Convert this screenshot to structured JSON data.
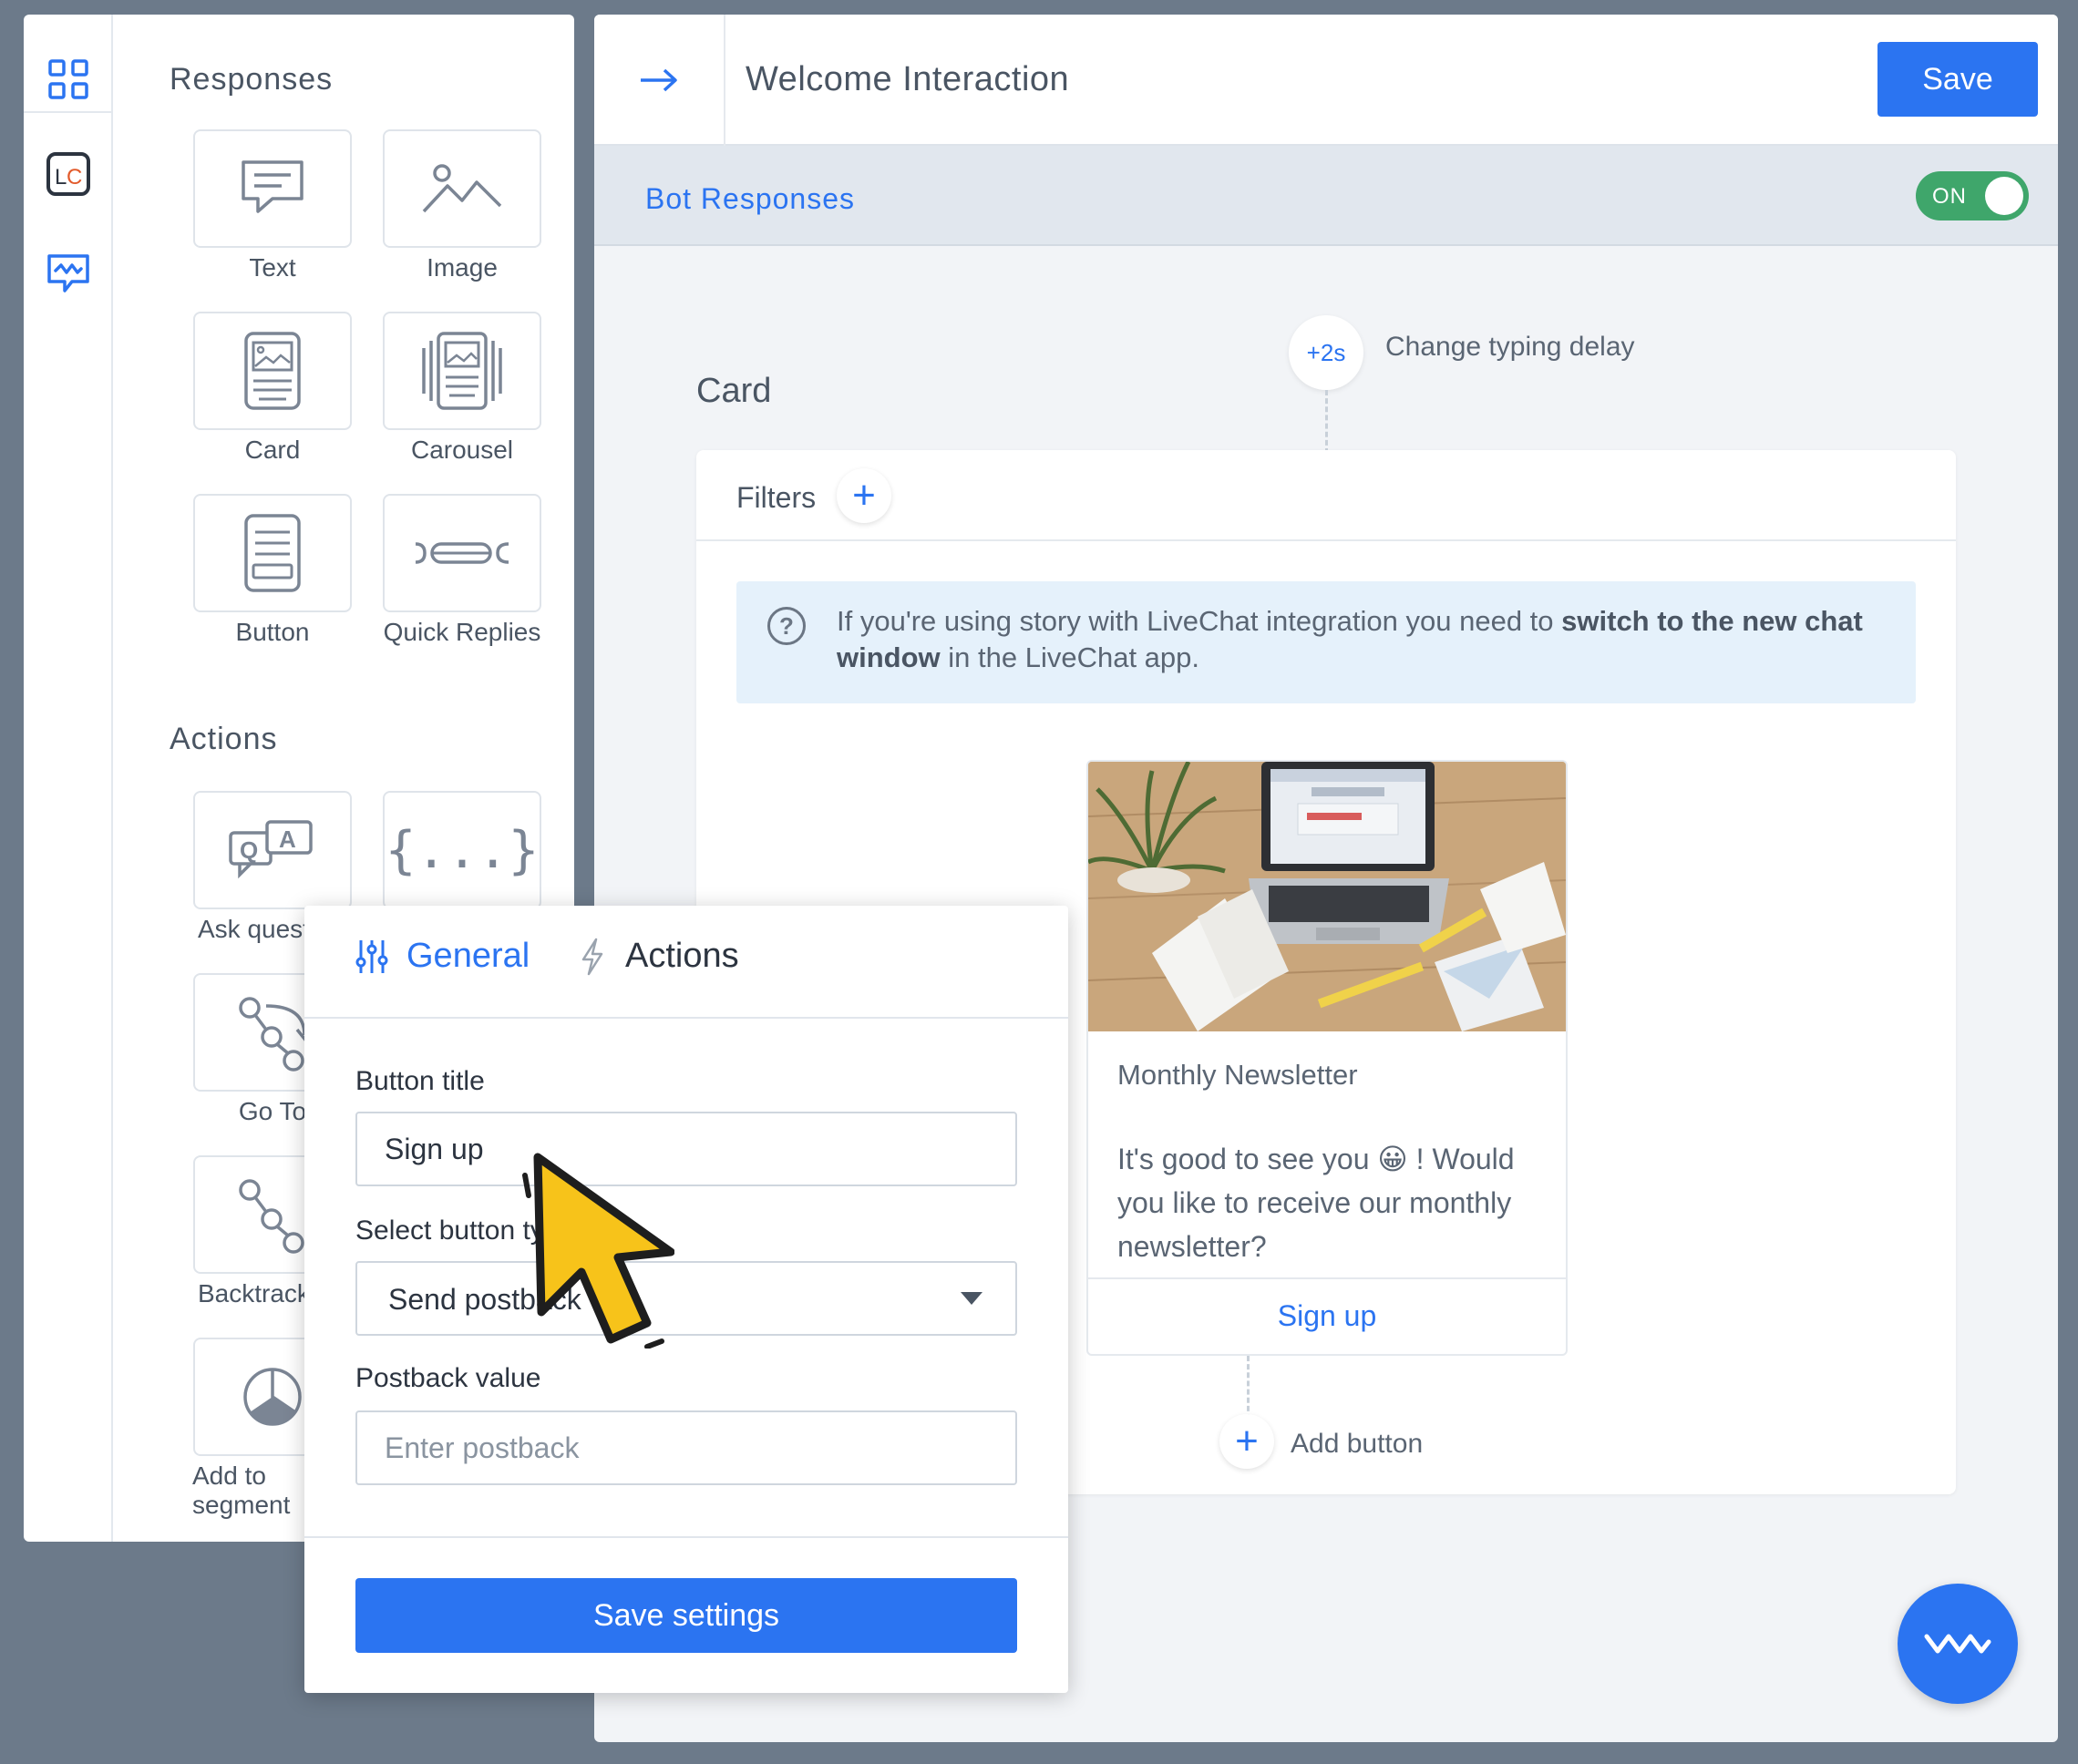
{
  "sidebar": {
    "responses_title": "Responses",
    "responses": [
      {
        "label": "Text",
        "icon": "text-bubble-icon"
      },
      {
        "label": "Image",
        "icon": "image-icon"
      },
      {
        "label": "Card",
        "icon": "card-icon"
      },
      {
        "label": "Carousel",
        "icon": "carousel-icon"
      },
      {
        "label": "Button",
        "icon": "button-icon"
      },
      {
        "label": "Quick Replies",
        "icon": "quick-replies-icon"
      }
    ],
    "actions_title": "Actions",
    "actions": [
      {
        "label": "Ask question",
        "icon": "qa-icon"
      },
      {
        "label": "{...}",
        "icon": "braces-icon"
      },
      {
        "label": "Go To",
        "icon": "goto-icon"
      },
      {
        "label": "Backtracking",
        "icon": "backtracking-icon"
      },
      {
        "label": "Add to segment",
        "icon": "pie-chart-icon"
      }
    ],
    "rail_icons": [
      "grid-icon",
      "lc-logo-icon",
      "chatbot-icon"
    ]
  },
  "header": {
    "title": "Welcome Interaction",
    "save_label": "Save"
  },
  "bot_responses": {
    "label": "Bot Responses",
    "toggle_label": "ON",
    "toggle_on": true
  },
  "typing_delay": {
    "value": "+2s",
    "label": "Change typing delay"
  },
  "card_section": {
    "heading": "Card",
    "filters_label": "Filters",
    "filters_add": "+",
    "info_text_1": "If you're using story with LiveChat integration you need to ",
    "info_bold": "switch to the new chat window",
    "info_text_2": " in the LiveChat app."
  },
  "message_card": {
    "title": "Monthly Newsletter",
    "body_1": "It's good to see you ",
    "emoji": "😀",
    "body_2": " ! Would you like to receive our monthly newsletter?",
    "button_label": "Sign up",
    "add_button_symbol": "+",
    "add_button_label": "Add button"
  },
  "popup": {
    "tab_general": "General",
    "tab_actions": "Actions",
    "button_title_label": "Button title",
    "button_title_value": "Sign up",
    "button_type_label": "Select button type",
    "button_type_value": "Send postback",
    "postback_label": "Postback value",
    "postback_placeholder": "Enter postback",
    "save_label": "Save settings"
  },
  "colors": {
    "accent": "#2b74f1",
    "toggle_on": "#3fa66b",
    "background": "#6c7a8a",
    "cursor": "#f7c31a"
  }
}
